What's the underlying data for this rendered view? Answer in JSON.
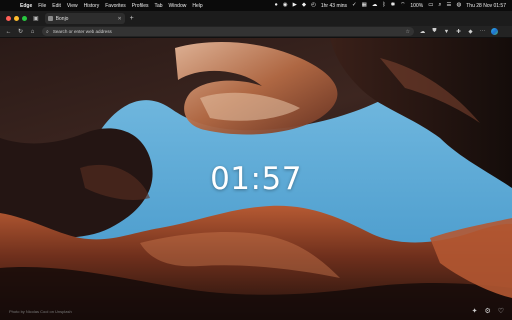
{
  "menubar": {
    "app_name": "Edge",
    "items": [
      "File",
      "Edit",
      "View",
      "History",
      "Favorites",
      "Profiles",
      "Tab",
      "Window",
      "Help"
    ],
    "timer": "1hr 43 mins",
    "battery": "100%",
    "datetime": "Thu 28 Nov 01:57"
  },
  "tab": {
    "title": "Bonjo"
  },
  "address": {
    "placeholder": "Search or enter web address"
  },
  "clock": {
    "time": "01:57"
  },
  "credit": {
    "text": "Photo by Nicolas Cool on Unsplash"
  },
  "colors": {
    "traffic_red": "#ff5f57",
    "traffic_yellow": "#febc2e",
    "traffic_green": "#28c840",
    "sky": "#4a9fd0"
  }
}
